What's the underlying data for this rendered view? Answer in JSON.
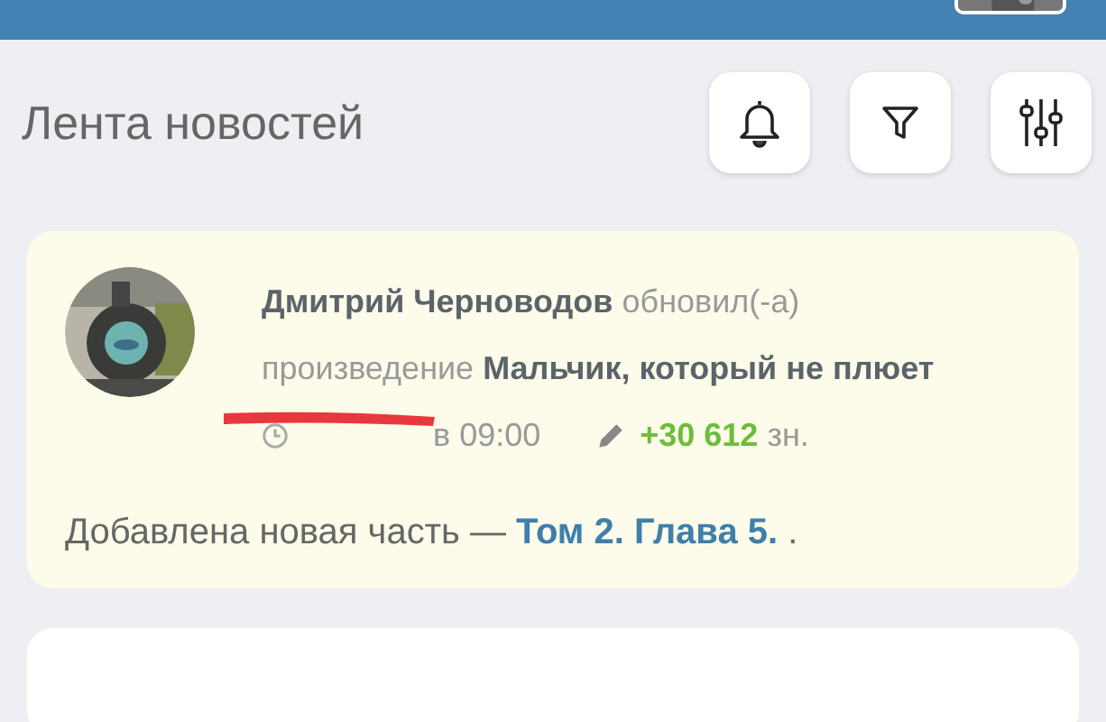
{
  "header": {
    "title": "Лента новостей",
    "buttons": [
      {
        "kind": "bell"
      },
      {
        "kind": "filter"
      },
      {
        "kind": "sliders"
      }
    ]
  },
  "feed": [
    {
      "summary": "**Дмитрий Черноводов** обновил(-а) произведение **Мальчик, который не плюет**",
      "time": "в 09:00",
      "redacted": true,
      "chars_added": "+30 612",
      "chars_unit": "зн.",
      "body_before": "Добавлена новая часть — ",
      "body_link": "Том 2. Глава 5.",
      "body_after": " ."
    }
  ]
}
